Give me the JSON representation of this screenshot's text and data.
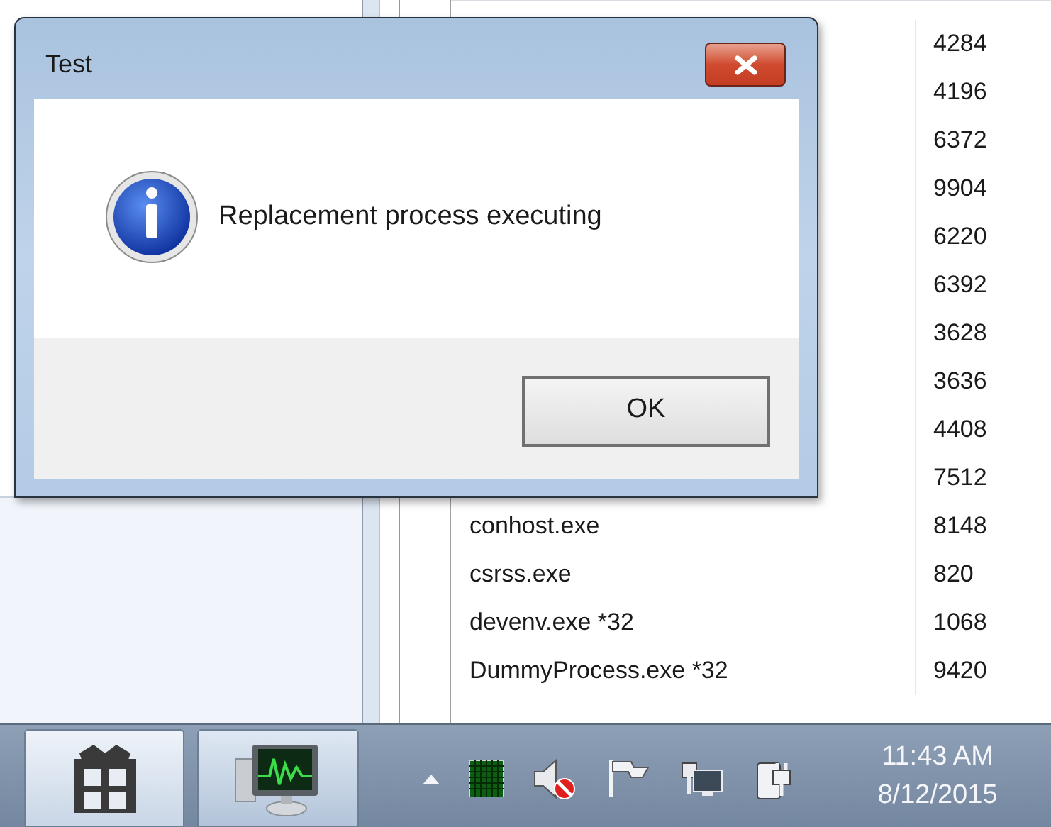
{
  "process_list": {
    "rows": [
      {
        "pid": "4284"
      },
      {
        "pid": "4196"
      },
      {
        "pid": "6372"
      },
      {
        "pid": "9904"
      },
      {
        "pid": "6220"
      },
      {
        "pid": "6392"
      },
      {
        "pid": "3628"
      },
      {
        "pid": "3636"
      },
      {
        "pid": "4408"
      },
      {
        "pid": "7512"
      },
      {
        "name": "conhost.exe",
        "pid": "8148"
      },
      {
        "name": "csrss.exe",
        "pid": "820"
      },
      {
        "name": "devenv.exe *32",
        "pid": "1068"
      },
      {
        "name": "DummyProcess.exe *32",
        "pid": "9420"
      }
    ]
  },
  "dialog": {
    "title": "Test",
    "message": "Replacement process executing",
    "buttons": [
      {
        "label": "OK"
      }
    ]
  },
  "taskbar": {
    "clock": {
      "time": "11:43 AM",
      "date": "8/12/2015"
    }
  }
}
